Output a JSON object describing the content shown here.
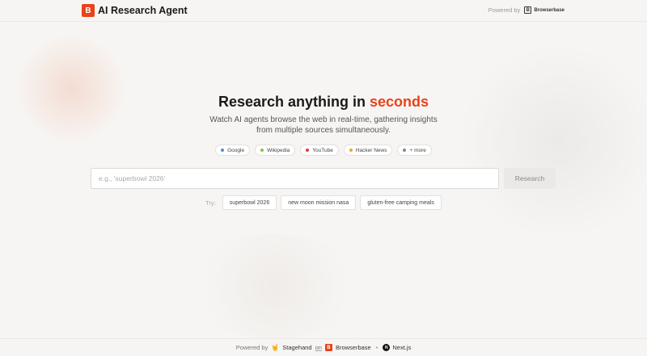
{
  "header": {
    "logo_letter": "B",
    "title": "AI Research Agent",
    "powered_by": "Powered by",
    "partner_letter": "B",
    "partner_name": "Browserbase"
  },
  "hero": {
    "title_main": "Research anything in ",
    "title_accent": "seconds",
    "subtitle": "Watch AI agents browse the web in real-time, gathering insights from multiple sources simultaneously.",
    "accent_color": "#e8431c"
  },
  "sources": [
    {
      "label": "Google",
      "color": "#4a90d9"
    },
    {
      "label": "Wikipedia",
      "color": "#7ac943"
    },
    {
      "label": "YouTube",
      "color": "#e53935"
    },
    {
      "label": "Hacker News",
      "color": "#f5a623"
    },
    {
      "label": "+ more",
      "color": "#888888"
    }
  ],
  "search": {
    "placeholder": "e.g., 'superbowl 2026'",
    "value": "",
    "button_label": "Research"
  },
  "suggestions": {
    "label": "Try:",
    "items": [
      "superbowl 2026",
      "new moon mission nasa",
      "gluten-free camping meals"
    ]
  },
  "footer": {
    "powered_by": "Powered by",
    "stagehand": "Stagehand",
    "on": "on",
    "browserbase_letter": "B",
    "browserbase": "Browserbase",
    "separator": "•",
    "next_letter": "N",
    "nextjs": "Next.js"
  }
}
